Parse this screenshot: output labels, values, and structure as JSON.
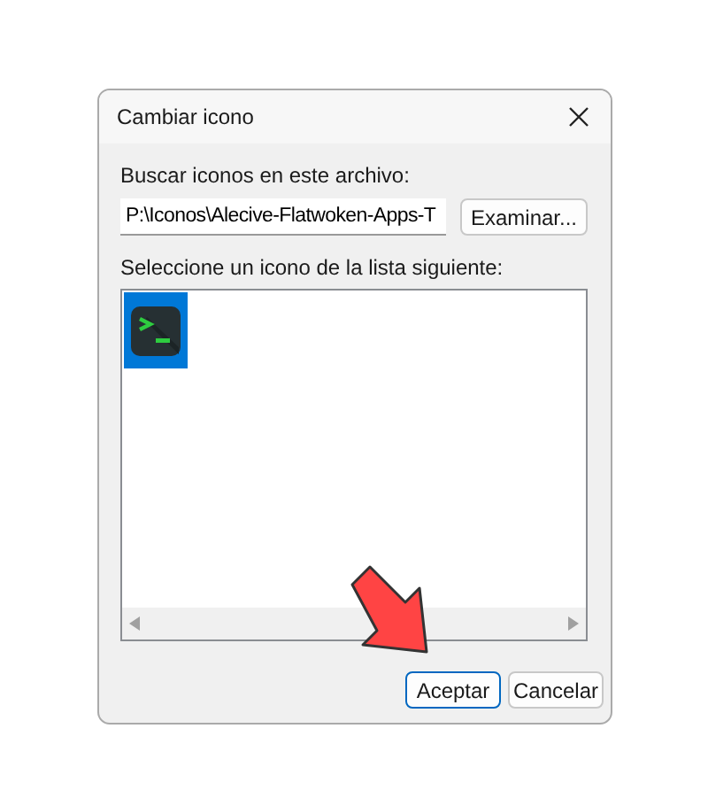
{
  "window": {
    "title": "Cambiar icono"
  },
  "file_label": "Buscar iconos en este archivo:",
  "file_path": {
    "value": "P:\\Iconos\\Alecive-Flatwoken-Apps-T"
  },
  "browse_button": "Examinar...",
  "list_label": "Seleccione un icono de la lista siguiente:",
  "icons": [
    {
      "selected": true
    }
  ],
  "buttons": [
    {
      "label": "Aceptar",
      "default": true
    },
    {
      "label": "Cancelar",
      "default": false
    }
  ]
}
